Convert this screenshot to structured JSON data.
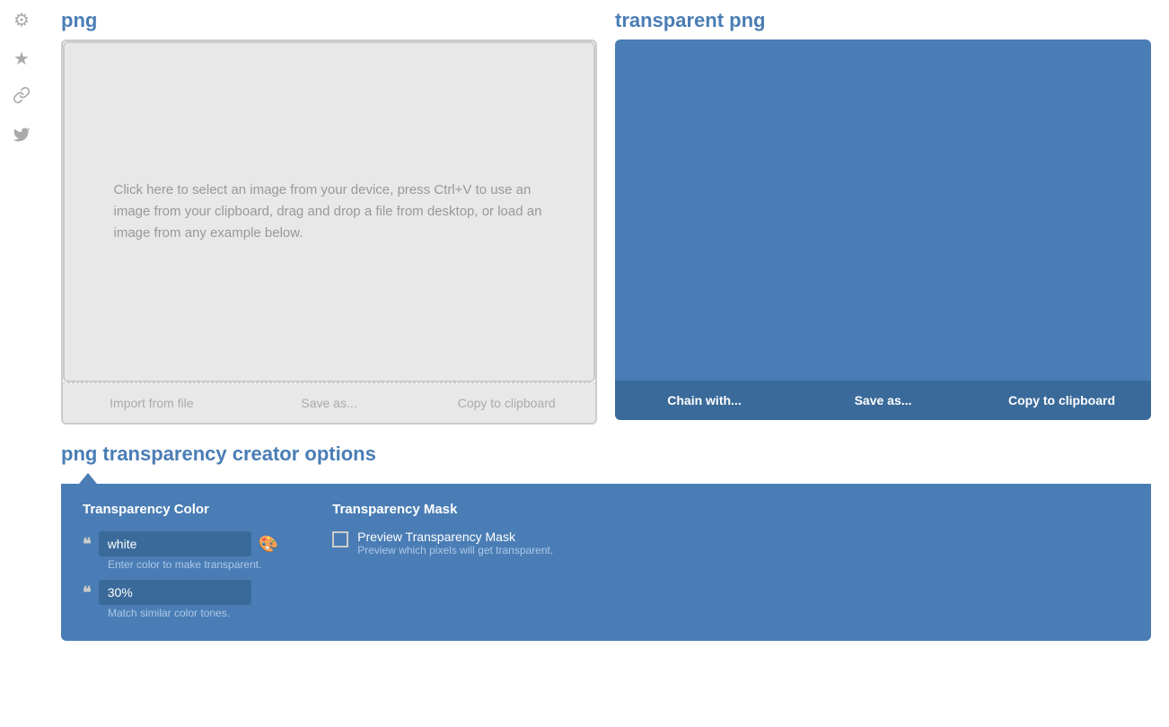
{
  "sidebar": {
    "icons": [
      {
        "name": "gear-icon",
        "symbol": "⚙"
      },
      {
        "name": "star-icon",
        "symbol": "★"
      },
      {
        "name": "link-icon",
        "symbol": "🔗"
      },
      {
        "name": "twitter-icon",
        "symbol": "🐦"
      }
    ]
  },
  "png_panel": {
    "title": "png",
    "upload_hint": "Click here to select an image from your device, press Ctrl+V to use an image from your clipboard, drag and drop a file from desktop, or load an image from any example below.",
    "actions": [
      {
        "label": "Import from file",
        "name": "import-from-file-btn"
      },
      {
        "label": "Save as...",
        "name": "save-as-btn"
      },
      {
        "label": "Copy to clipboard",
        "name": "copy-to-clipboard-btn"
      }
    ]
  },
  "transparent_panel": {
    "title": "transparent png",
    "actions": [
      {
        "label": "Chain with...",
        "name": "chain-with-btn"
      },
      {
        "label": "Save as...",
        "name": "transparent-save-as-btn"
      },
      {
        "label": "Copy to clipboard",
        "name": "transparent-copy-clipboard-btn"
      }
    ]
  },
  "options": {
    "title": "png transparency creator options",
    "transparency_color": {
      "label": "Transparency Color",
      "input_value": "white",
      "input_placeholder": "white",
      "hint": "Enter color to make transparent."
    },
    "tolerance": {
      "input_value": "30%",
      "hint": "Match similar color tones."
    },
    "transparency_mask": {
      "label": "Transparency Mask",
      "checkbox_label": "Preview Transparency Mask",
      "checkbox_sublabel": "Preview which pixels will get transparent.",
      "checked": false
    }
  },
  "colors": {
    "blue": "#4a7db5",
    "dark_blue": "#3a6a9a",
    "panel_bg": "#4a7db5"
  }
}
